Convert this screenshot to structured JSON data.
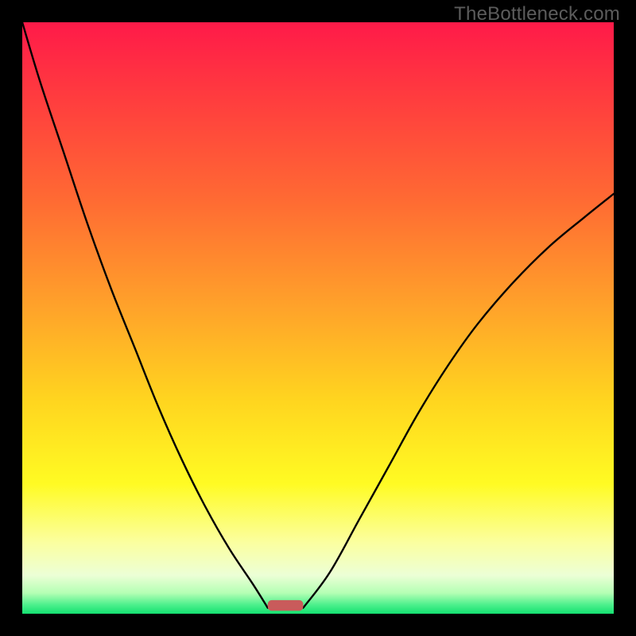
{
  "watermark": "TheBottleneck.com",
  "colors": {
    "frame": "#000000",
    "curve": "#000000",
    "marker": "#c95b5b",
    "gradient_stops": [
      {
        "offset": 0.0,
        "color": "#ff1a49"
      },
      {
        "offset": 0.12,
        "color": "#ff3a3f"
      },
      {
        "offset": 0.3,
        "color": "#ff6a33"
      },
      {
        "offset": 0.48,
        "color": "#ffa22a"
      },
      {
        "offset": 0.64,
        "color": "#ffd51f"
      },
      {
        "offset": 0.78,
        "color": "#fffb23"
      },
      {
        "offset": 0.88,
        "color": "#fbffa0"
      },
      {
        "offset": 0.935,
        "color": "#ecffd6"
      },
      {
        "offset": 0.965,
        "color": "#b4ffb4"
      },
      {
        "offset": 0.985,
        "color": "#4cf08c"
      },
      {
        "offset": 1.0,
        "color": "#15e070"
      }
    ]
  },
  "chart_data": {
    "type": "line",
    "title": "",
    "xlabel": "",
    "ylabel": "",
    "xlim": [
      0,
      1
    ],
    "ylim": [
      0,
      1
    ],
    "optimum_x": 0.44,
    "marker": {
      "x0": 0.415,
      "x1": 0.475,
      "y": 0.005,
      "height": 0.018
    },
    "series": [
      {
        "name": "left-branch",
        "x": [
          0.0,
          0.03,
          0.07,
          0.11,
          0.15,
          0.19,
          0.23,
          0.27,
          0.31,
          0.35,
          0.39,
          0.415
        ],
        "y": [
          1.0,
          0.9,
          0.78,
          0.66,
          0.55,
          0.45,
          0.35,
          0.26,
          0.18,
          0.11,
          0.05,
          0.01
        ]
      },
      {
        "name": "right-branch",
        "x": [
          0.475,
          0.52,
          0.57,
          0.62,
          0.67,
          0.72,
          0.77,
          0.83,
          0.89,
          0.95,
          1.0
        ],
        "y": [
          0.01,
          0.07,
          0.16,
          0.25,
          0.34,
          0.42,
          0.49,
          0.56,
          0.62,
          0.67,
          0.71
        ]
      }
    ]
  }
}
